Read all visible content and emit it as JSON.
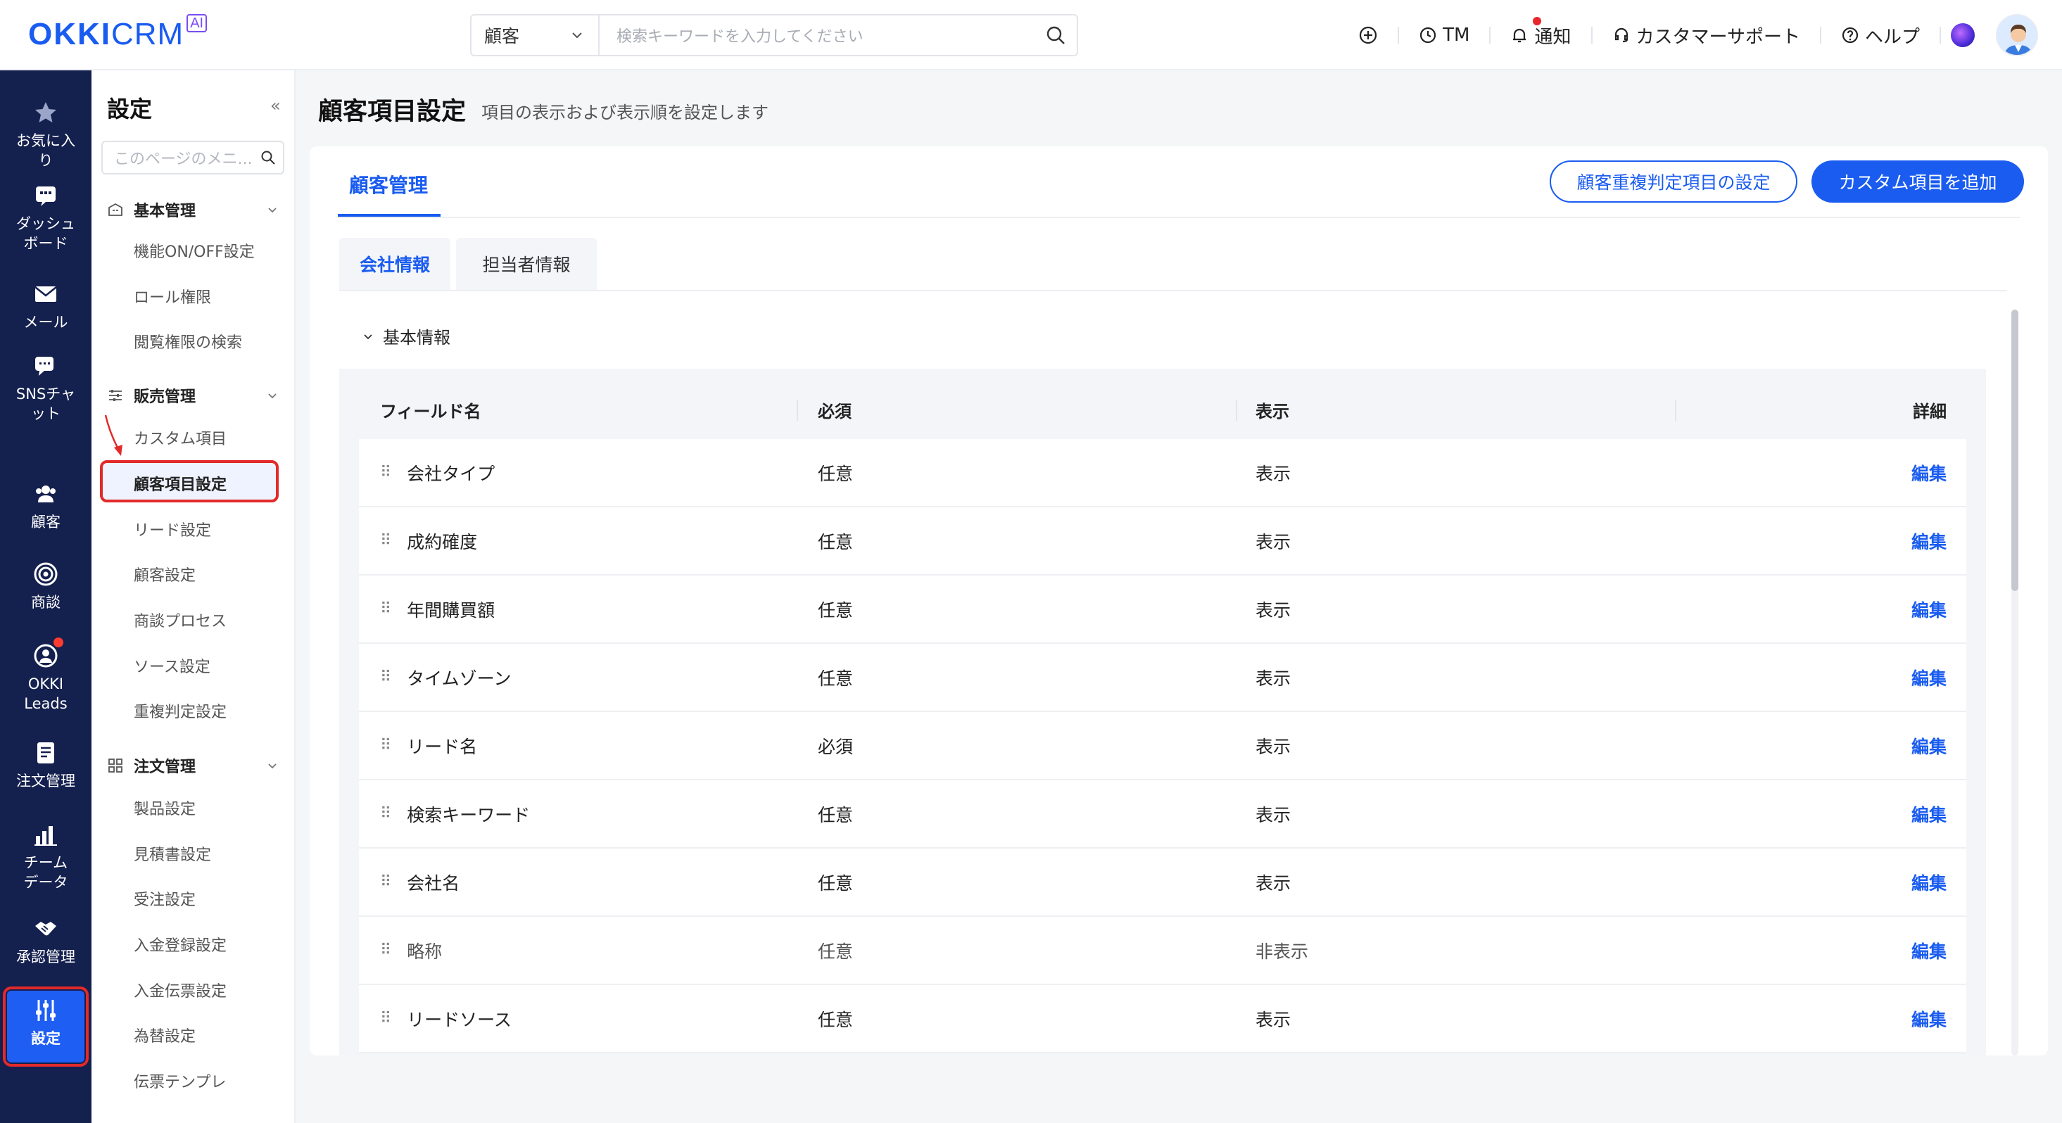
{
  "brand": {
    "okki": "OKKI",
    "crm": "CRM",
    "ai": "AI"
  },
  "search": {
    "scope": "顧客",
    "placeholder": "検索キーワードを入力してください"
  },
  "topnav": {
    "tm": "TM",
    "notice": "通知",
    "support": "カスタマーサポート",
    "help": "ヘルプ"
  },
  "rail": {
    "favorites": "お気に入り",
    "dashboard": "ダッシュボード",
    "mail": "メール",
    "sns": "SNSチャット",
    "customer": "顧客",
    "deal": "商談",
    "leads": "OKKI Leads",
    "orders": "注文管理",
    "team": "チームデータ",
    "approval": "承認管理",
    "settings": "設定"
  },
  "sidebar": {
    "title": "設定",
    "collapse": "«",
    "search_placeholder": "このページのメニ...",
    "groups": [
      {
        "label": "基本管理",
        "items": [
          "機能ON/OFF設定",
          "ロール権限",
          "閲覧権限の検索"
        ]
      },
      {
        "label": "販売管理",
        "items": [
          "カスタム項目",
          "顧客項目設定",
          "リード設定",
          "顧客設定",
          "商談プロセス",
          "ソース設定",
          "重複判定設定"
        ]
      },
      {
        "label": "注文管理",
        "items": [
          "製品設定",
          "見積書設定",
          "受注設定",
          "入金登録設定",
          "入金伝票設定",
          "為替設定",
          "伝票テンプレ"
        ]
      }
    ],
    "active_item": "顧客項目設定"
  },
  "main": {
    "title": "顧客項目設定",
    "subtitle": "項目の表示および表示順を設定します",
    "tab": "顧客管理",
    "btn_dup": "顧客重複判定項目の設定",
    "btn_add": "カスタム項目を追加",
    "subtabs": [
      "会社情報",
      "担当者情報"
    ],
    "section": "基本情報"
  },
  "table": {
    "headers": [
      "フィールド名",
      "必須",
      "表示",
      "詳細"
    ],
    "rows": [
      {
        "name": "会社タイプ",
        "required": "任意",
        "display": "表示",
        "action": "編集",
        "locked": false
      },
      {
        "name": "成約確度",
        "required": "任意",
        "display": "表示",
        "action": "編集",
        "locked": false
      },
      {
        "name": "年間購買額",
        "required": "任意",
        "display": "表示",
        "action": "編集",
        "locked": false
      },
      {
        "name": "タイムゾーン",
        "required": "任意",
        "display": "表示",
        "action": "編集",
        "locked": false
      },
      {
        "name": "リード名",
        "required": "必須",
        "display": "表示",
        "action": "編集",
        "locked": false
      },
      {
        "name": "検索キーワード",
        "required": "任意",
        "display": "表示",
        "action": "編集",
        "locked": false
      },
      {
        "name": "会社名",
        "required": "任意",
        "display": "表示",
        "action": "編集",
        "locked": false
      },
      {
        "name": "略称",
        "required": "任意",
        "display": "非表示",
        "action": "編集",
        "locked": true
      },
      {
        "name": "リードソース",
        "required": "任意",
        "display": "表示",
        "action": "編集",
        "locked": false
      }
    ]
  },
  "colors": {
    "accent": "#1a5cf0",
    "rail": "#14204e",
    "highlight": "#e22a2a"
  }
}
